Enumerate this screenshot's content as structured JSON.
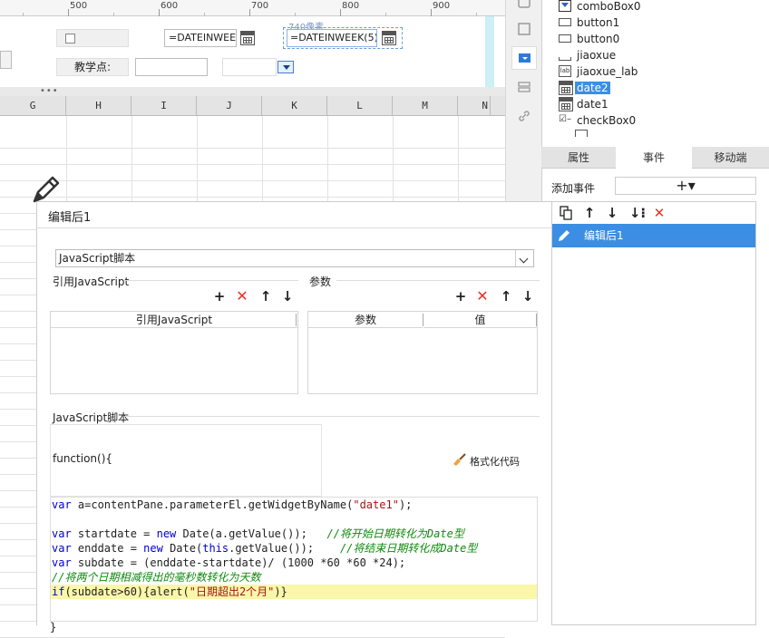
{
  "ruler": {
    "labels": [
      "500",
      "600",
      "700",
      "800",
      "900"
    ]
  },
  "form": {
    "date_field1": "=DATEINWEE",
    "date_field2": "=DATEINWEEK(5)",
    "size_hint": "740像素",
    "label_teaching": "教学点:"
  },
  "sheet": {
    "columns": [
      "G",
      "H",
      "I",
      "J",
      "K",
      "L",
      "M",
      "N"
    ]
  },
  "widget_tree": {
    "items": [
      {
        "icon": "combobox-icon",
        "label": "comboBox0"
      },
      {
        "icon": "button-icon",
        "label": "button1"
      },
      {
        "icon": "button-icon",
        "label": "button0"
      },
      {
        "icon": "textbox-icon",
        "label": "jiaoxue"
      },
      {
        "icon": "label-icon",
        "label": "jiaoxue_lab"
      },
      {
        "icon": "calendar-icon",
        "label": "date2",
        "selected": true
      },
      {
        "icon": "calendar-icon",
        "label": "date1"
      },
      {
        "icon": "checkbox-icon",
        "label": "checkBox0"
      }
    ]
  },
  "prop_tabs": {
    "attr": "属性",
    "event": "事件",
    "mobile": "移动端"
  },
  "events": {
    "add_label": "添加事件",
    "add_button": "+▾",
    "item_label": "编辑后1"
  },
  "dialog": {
    "title": "编辑后1",
    "script_type": "JavaScript脚本",
    "ref_js_title": "引用JavaScript",
    "params_title": "参数",
    "ref_js_col": "引用JavaScript",
    "param_col": "参数",
    "value_col": "值",
    "js_script_title": "JavaScript脚本",
    "function_header": "function(){",
    "format_label": "格式化代码",
    "close_brace": "}"
  },
  "code": {
    "line1": "var a=contentPane.parameterEl.getWidgetByName(\"date1\");",
    "line3": "var startdate = new Date(a.getValue());   //将开始日期转化为Date型",
    "line4": "var enddate = new Date(this.getValue());    //将结束日期转化成Date型",
    "line5": "var subdate = (enddate-startdate)/ (1000 *60 *60 *24);",
    "line6": "//将两个日期相减得出的毫秒数转化为天数",
    "line7": "if(subdate>60){alert(\"日期超出2个月\")}"
  },
  "colors": {
    "accent": "#3b8ee3",
    "delete": "#e0342b",
    "highlight": "#fbf7a8"
  }
}
